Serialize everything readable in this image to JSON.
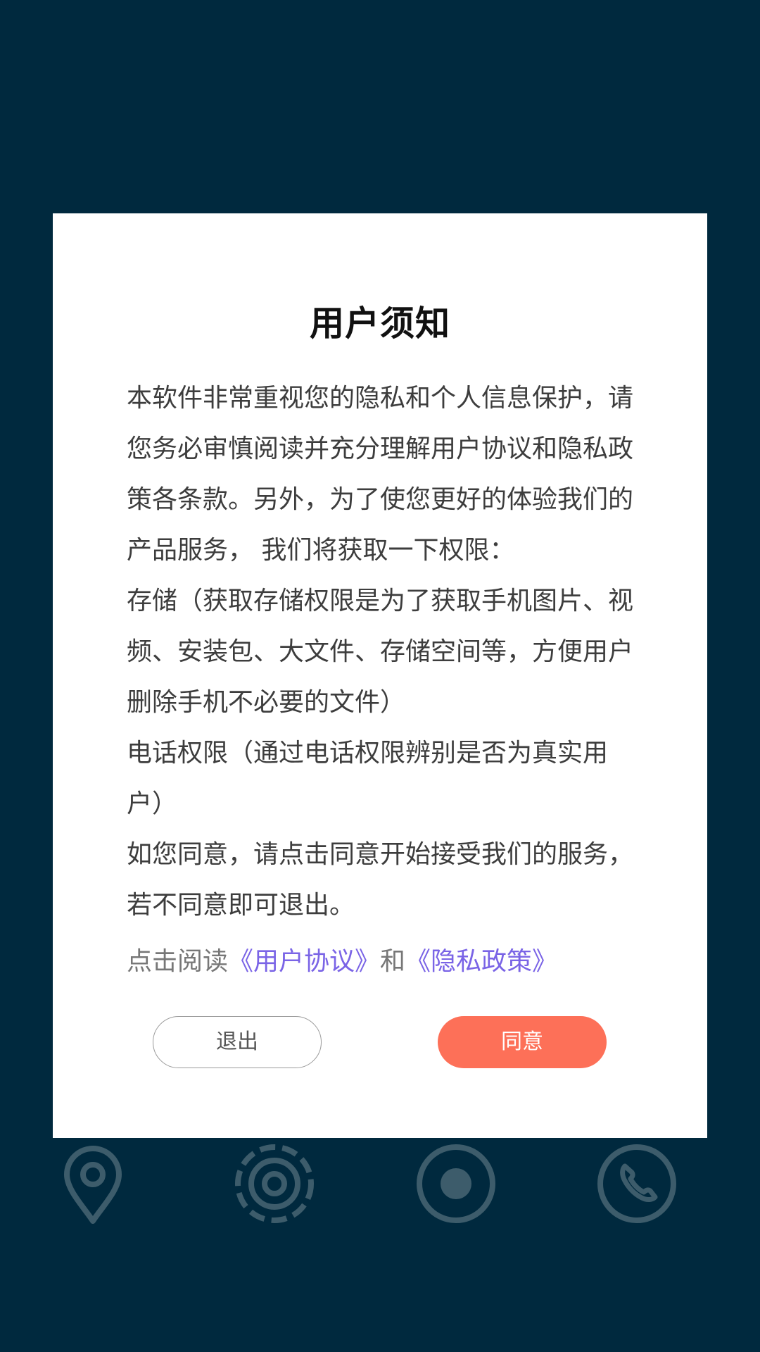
{
  "dialog": {
    "title": "用户须知",
    "paragraphs": [
      "本软件非常重视您的隐私和个人信息保护，请您务必审慎阅读并充分理解用户协议和隐私政策各条款。另外，为了使您更好的体验我们的产品服务， 我们将获取一下权限：",
      "存储（获取存储权限是为了获取手机图片、视频、安装包、大文件、存储空间等，方便用户删除手机不必要的文件）",
      "电话权限（通过电话权限辨别是否为真实用户）",
      "如您同意，请点击同意开始接受我们的服务，若不同意即可退出。"
    ],
    "read_prefix": "点击阅读",
    "user_agreement_link": "《用户协议》",
    "read_and": "和",
    "privacy_policy_link": "《隐私政策》",
    "exit_label": "退出",
    "agree_label": "同意"
  },
  "bottom_icons": [
    "location-pin-icon",
    "radar-scan-icon",
    "record-icon",
    "phone-icon"
  ],
  "colors": {
    "background": "#00293e",
    "agree_button": "#fd7058",
    "link": "#7a64e6",
    "icon_stroke": "#4b6570"
  }
}
